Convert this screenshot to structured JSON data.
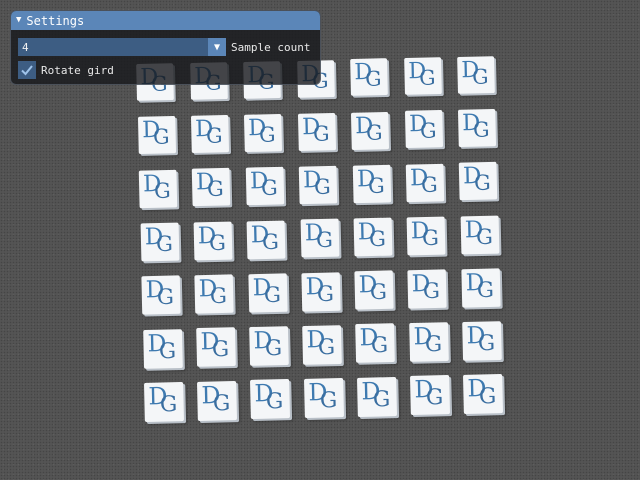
{
  "scene": {
    "rows": 7,
    "cols": 7,
    "tile_logo": {
      "left": "D",
      "right": "G"
    },
    "colors": {
      "background": "#545454",
      "tile": "#f4f6f8",
      "logo_blue": "#3e7ab0"
    }
  },
  "settings": {
    "title": "Settings",
    "collapse_icon": "triangle-down-icon",
    "sample_count": {
      "value": "4",
      "label": "Sample count",
      "dropdown_icon": "triangle-down-icon"
    },
    "rotate_grid": {
      "checked": true,
      "label": "Rotate gird",
      "check_icon": "checkmark-icon"
    },
    "colors": {
      "title_bar": "#5b86b8",
      "frame": "#3d5d83",
      "text": "#e8e8e8"
    }
  }
}
